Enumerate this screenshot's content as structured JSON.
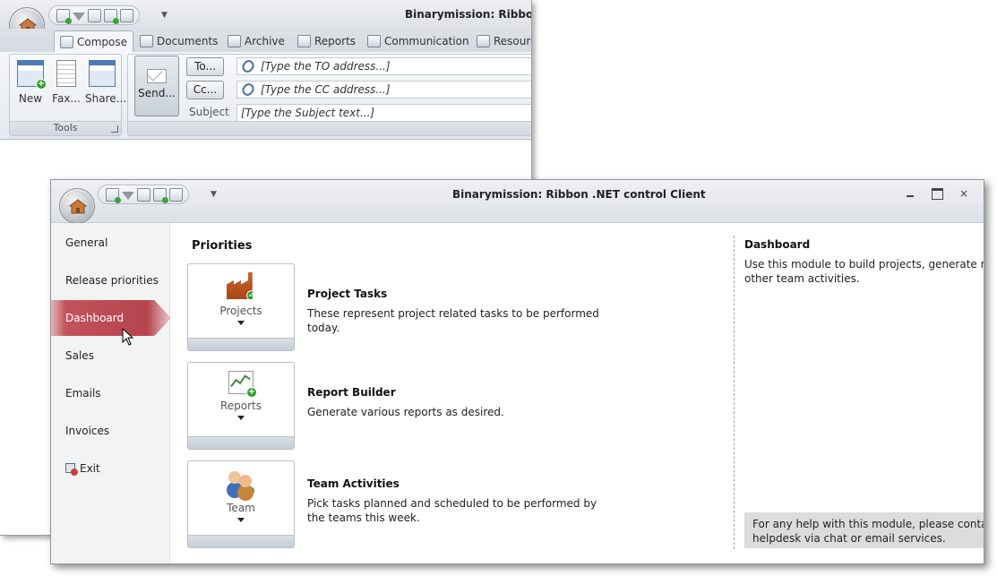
{
  "back_window": {
    "title": "Binarymission: Ribbon .N",
    "tabs": [
      {
        "label": "Compose"
      },
      {
        "label": "Documents"
      },
      {
        "label": "Archive"
      },
      {
        "label": "Reports"
      },
      {
        "label": "Communication"
      },
      {
        "label": "Resourc"
      }
    ],
    "tools_group": {
      "label": "Tools",
      "buttons": [
        {
          "label": "New"
        },
        {
          "label": "Fax..."
        },
        {
          "label": "Share..."
        }
      ]
    },
    "compose": {
      "send_label": "Send...",
      "to_label": "To...",
      "cc_label": "Cc...",
      "subject_label": "Subject",
      "to_value": "[Type the TO address...]",
      "cc_value": "[Type the CC address...]",
      "subject_value": "[Type the Subject text...]"
    }
  },
  "front_window": {
    "title": "Binarymission: Ribbon .NET control Client",
    "controls": {
      "close": "×"
    },
    "nav": [
      {
        "label": "General"
      },
      {
        "label": "Release priorities"
      },
      {
        "label": "Dashboard"
      },
      {
        "label": "Sales"
      },
      {
        "label": "Emails"
      },
      {
        "label": "Invoices"
      },
      {
        "label": "Exit"
      }
    ],
    "active_nav": "Dashboard",
    "priorities": {
      "title": "Priorities",
      "items": [
        {
          "button": "Projects",
          "title": "Project Tasks",
          "description": "These represent project related tasks to be performed today."
        },
        {
          "button": "Reports",
          "title": "Report Builder",
          "description": "Generate various reports as desired."
        },
        {
          "button": "Team",
          "title": "Team Activities",
          "description": "Pick tasks planned and scheduled to be performed by the teams this week."
        }
      ]
    },
    "info_panel": {
      "title": "Dashboard",
      "text": "Use this module to build projects, generate reports and perform other team activities.",
      "help": "For any help with this module, please contact Utilities helpdesk via chat or email services."
    }
  },
  "colors": {
    "active_nav": "#b6444e",
    "titlebar": "#dde1e6",
    "help_box": "#dcdcdc"
  },
  "icons": {
    "orb": "house-icon",
    "qat": [
      "refresh-icon",
      "filter-icon",
      "new-item-icon",
      "add-icon",
      "preview-icon"
    ],
    "exit": "exit-icon"
  }
}
